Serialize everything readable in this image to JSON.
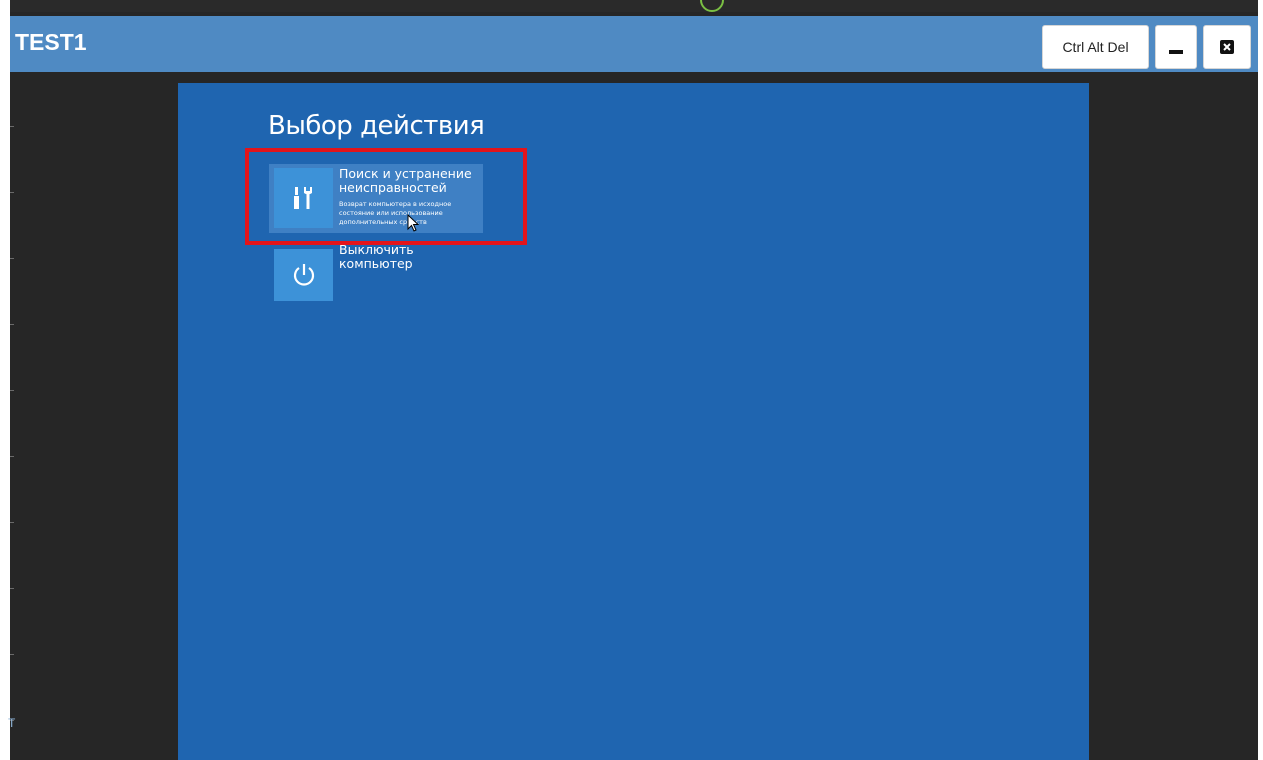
{
  "window": {
    "title": "TEST1",
    "ctrl_alt_del_label": "Ctrl Alt Del"
  },
  "recovery": {
    "heading": "Выбор действия",
    "options": [
      {
        "title": "Поиск и устранение неисправностей",
        "subtitle": "Возврат компьютера в исходное состояние или использование дополнительных средств",
        "icon": "tools-icon"
      },
      {
        "title": "Выключить компьютер",
        "icon": "power-icon"
      }
    ]
  },
  "side_marker": "T",
  "colors": {
    "titlebar": "#4f8ac3",
    "screen_bg": "#1f65b0",
    "tile": "#3d92d8",
    "selected_option": "#3f80c4",
    "highlight": "#e3141b",
    "window_bg": "#262626"
  }
}
